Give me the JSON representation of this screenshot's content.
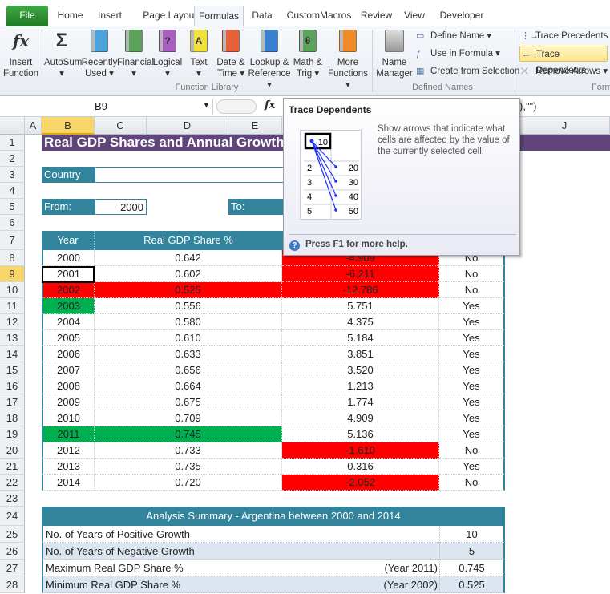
{
  "tabs": [
    "File",
    "Home",
    "Insert",
    "Page Layout",
    "Formulas",
    "Data",
    "CustomMacros",
    "Review",
    "View",
    "Developer"
  ],
  "active_tab": "Formulas",
  "ribbon": {
    "function_library": {
      "group_label": "Function Library",
      "buttons": [
        {
          "l1": "Insert",
          "l2": "Function",
          "icon": "fx-icon"
        },
        {
          "l1": "AutoSum",
          "l2": "▾",
          "icon": "sigma-icon"
        },
        {
          "l1": "Recently",
          "l2": "Used ▾",
          "icon": "star-book-icon",
          "color": "#4da3d9"
        },
        {
          "l1": "Financial",
          "l2": "▾",
          "icon": "money-book-icon",
          "color": "#5ba35b"
        },
        {
          "l1": "Logical",
          "l2": "▾",
          "icon": "question-book-icon",
          "color": "#a95fc0",
          "glyph": "?"
        },
        {
          "l1": "Text",
          "l2": "▾",
          "icon": "text-book-icon",
          "color": "#f0e23a",
          "glyph": "A"
        },
        {
          "l1": "Date &",
          "l2": "Time ▾",
          "icon": "calendar-book-icon",
          "color": "#e8603a"
        },
        {
          "l1": "Lookup &",
          "l2": "Reference ▾",
          "icon": "magnifier-book-icon",
          "color": "#3b7fd0"
        },
        {
          "l1": "Math &",
          "l2": "Trig ▾",
          "icon": "theta-book-icon",
          "color": "#5ba35b",
          "glyph": "θ"
        },
        {
          "l1": "More",
          "l2": "Functions ▾",
          "icon": "books-icon",
          "color": "#f08a2a"
        }
      ]
    },
    "defined_names": {
      "group_label": "Defined Names",
      "name_manager": {
        "l1": "Name",
        "l2": "Manager"
      },
      "items": [
        "Define Name ▾",
        "Use in Formula ▾",
        "Create from Selection"
      ]
    },
    "formula_auditing": {
      "group_label": "Form",
      "items": [
        "Trace Precedents",
        "Trace Dependents",
        "Remove Arrows ▾"
      ]
    }
  },
  "formula_bar": {
    "name_box": "B9",
    "formula_visible": "),\"\")"
  },
  "columns": [
    "A",
    "B",
    "C",
    "D",
    "E",
    "J"
  ],
  "sheet": {
    "title": "Real GDP Shares and Annual Growth Ra",
    "country_label": "Country",
    "from_label": "From:",
    "from_value": "2000",
    "to_label": "To:",
    "headers": {
      "year": "Year",
      "share": "Real GDP Share %"
    },
    "rows": [
      {
        "year": "2000",
        "share": "0.642",
        "growth": "-4.909",
        "positive": "No"
      },
      {
        "year": "2001",
        "share": "0.602",
        "growth": "-6.211",
        "positive": "No"
      },
      {
        "year": "2002",
        "share": "0.525",
        "growth": "-12.786",
        "positive": "No"
      },
      {
        "year": "2003",
        "share": "0.556",
        "growth": "5.751",
        "positive": "Yes"
      },
      {
        "year": "2004",
        "share": "0.580",
        "growth": "4.375",
        "positive": "Yes"
      },
      {
        "year": "2005",
        "share": "0.610",
        "growth": "5.184",
        "positive": "Yes"
      },
      {
        "year": "2006",
        "share": "0.633",
        "growth": "3.851",
        "positive": "Yes"
      },
      {
        "year": "2007",
        "share": "0.656",
        "growth": "3.520",
        "positive": "Yes"
      },
      {
        "year": "2008",
        "share": "0.664",
        "growth": "1.213",
        "positive": "Yes"
      },
      {
        "year": "2009",
        "share": "0.675",
        "growth": "1.774",
        "positive": "Yes"
      },
      {
        "year": "2010",
        "share": "0.709",
        "growth": "4.909",
        "positive": "Yes"
      },
      {
        "year": "2011",
        "share": "0.745",
        "growth": "5.136",
        "positive": "Yes"
      },
      {
        "year": "2012",
        "share": "0.733",
        "growth": "-1.610",
        "positive": "No"
      },
      {
        "year": "2013",
        "share": "0.735",
        "growth": "0.316",
        "positive": "Yes"
      },
      {
        "year": "2014",
        "share": "0.720",
        "growth": "-2.052",
        "positive": "No"
      }
    ],
    "summary": {
      "title": "Analysis Summary - Argentina between 2000 and 2014",
      "rows": [
        {
          "label": "No. of Years of Positive Growth",
          "note": "",
          "value": "10"
        },
        {
          "label": "No. of Years of Negative Growth",
          "note": "",
          "value": "5"
        },
        {
          "label": "Maximum Real GDP Share %",
          "note": "(Year 2011)",
          "value": "0.745"
        },
        {
          "label": "Minimum Real GDP Share %",
          "note": "(Year 2002)",
          "value": "0.525"
        }
      ]
    }
  },
  "tooltip": {
    "title": "Trace Dependents",
    "description": "Show arrows that indicate what cells are affected by the value of the currently selected cell.",
    "help": "Press F1 for more help.",
    "illustration": {
      "source": "10",
      "rows": [
        [
          "2",
          "20"
        ],
        [
          "3",
          "30"
        ],
        [
          "4",
          "40"
        ],
        [
          "5",
          "50"
        ]
      ]
    }
  },
  "colors": {
    "title_bg": "#5f4579",
    "header_teal": "#31849b",
    "negative_red": "#ff0000",
    "highlight_green": "#00b050",
    "summary_alt": "#dce6f1"
  }
}
